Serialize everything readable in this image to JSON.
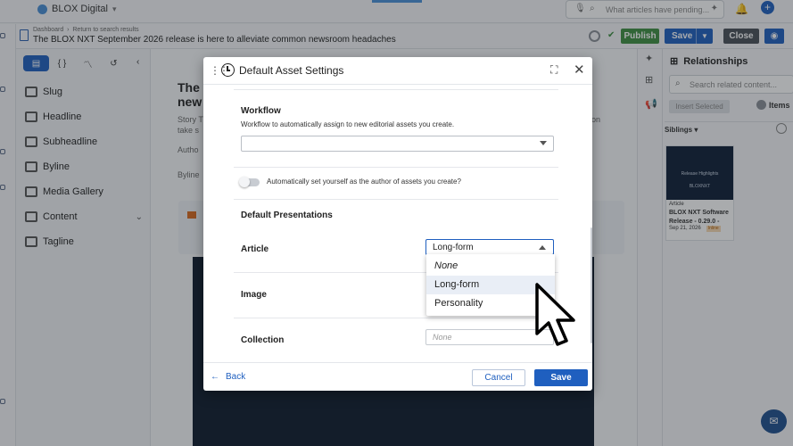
{
  "app": {
    "brand": "BLOX Digital"
  },
  "top_search": {
    "placeholder": "What articles have pending..."
  },
  "header": {
    "breadcrumb_dashboard": "Dashboard",
    "breadcrumb_return": "Return to search results",
    "title": "The BLOX NXT September 2026 release is here to alleviate common newsroom headaches",
    "publish": "Publish",
    "save": "Save",
    "close": "Close"
  },
  "sidebar": {
    "items": [
      {
        "label": "Slug"
      },
      {
        "label": "Headline"
      },
      {
        "label": "Subheadline"
      },
      {
        "label": "Byline"
      },
      {
        "label": "Media Gallery"
      },
      {
        "label": "Content"
      },
      {
        "label": "Tagline"
      }
    ]
  },
  "editor": {
    "title_fragment": "The",
    "title_fragment2": "new",
    "story_fragment": "Story T",
    "story_fragment2": "take s",
    "author_fragment": "Autho",
    "byline_fragment": "Byline",
    "right_fragment": "ion"
  },
  "relationships": {
    "title": "Relationships",
    "search_placeholder": "Search related content...",
    "insert_selected": "Insert Selected",
    "items_label": "Items",
    "siblings_label": "Siblings",
    "card": {
      "thumb_title": "Release Highlights",
      "thumb_brand": "BLOXNXT",
      "type": "Article",
      "title": "BLOX NXT Software Release - 0.29.0 -",
      "date": "Sep 21, 2026",
      "badge": "Inline"
    }
  },
  "modal": {
    "title": "Default Asset Settings",
    "workflow_label": "Workflow",
    "workflow_help": "Workflow to automatically assign to new editorial assets you create.",
    "workflow_value": "",
    "toggle_label": "Automatically set yourself as the author of assets you create?",
    "toggle_on": false,
    "presentations_heading": "Default Presentations",
    "article_label": "Article",
    "article_value": "Long-form",
    "image_label": "Image",
    "collection_label": "Collection",
    "collection_value": "None",
    "dropdown_options": [
      "None",
      "Long-form",
      "Personality"
    ],
    "dropdown_highlighted": "Long-form",
    "back": "Back",
    "cancel": "Cancel",
    "save": "Save"
  },
  "icons": {
    "brand": "blox-logo-icon",
    "clock": "clock-icon",
    "expand": "expand-icon",
    "close": "close-icon",
    "drag": "drag-handle-icon",
    "back": "arrow-left-icon",
    "cursor": "pointer-cursor-icon"
  },
  "colors": {
    "accent": "#1f5fbf",
    "publish": "#3e8e41",
    "highlight": "#e9eef6"
  }
}
